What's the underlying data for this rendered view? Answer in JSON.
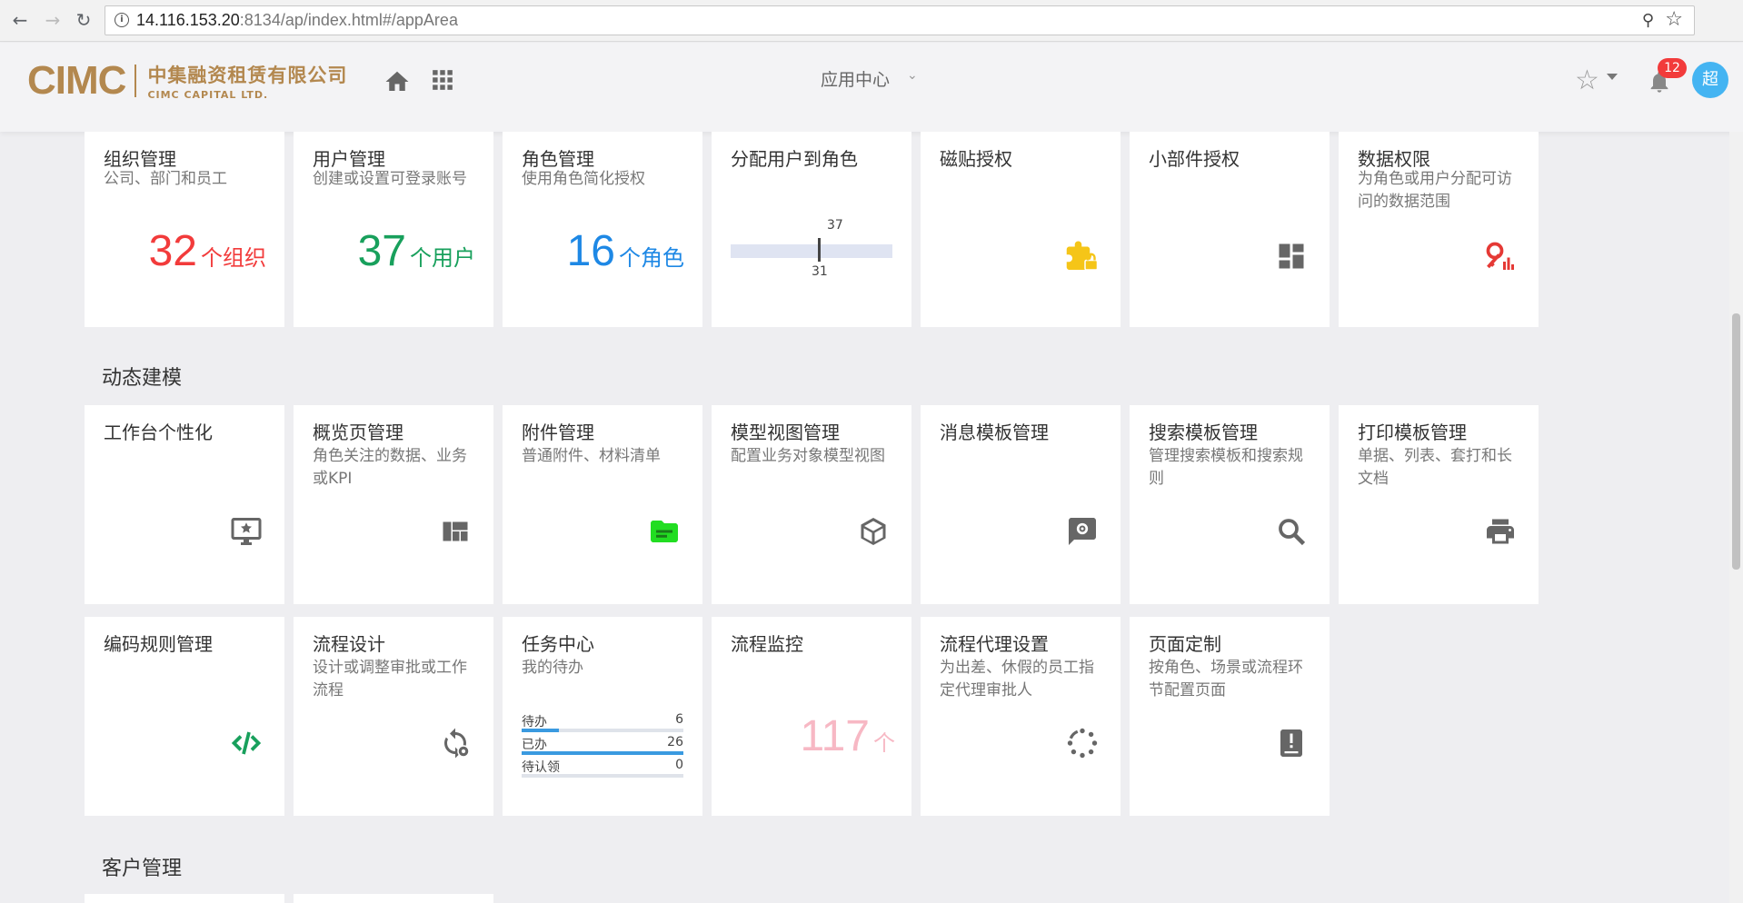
{
  "browser": {
    "url_host": "14.116.153.20",
    "url_rest": ":8134/ap/index.html#/appArea"
  },
  "header": {
    "logo_mark": "CIMC",
    "logo_cn": "中集融资租赁有限公司",
    "logo_en": "CIMC CAPITAL LTD.",
    "app_center": "应用中心",
    "notifications": "12",
    "avatar": "超"
  },
  "sections": {
    "dynamic_modeling": "动态建模",
    "customer_mgmt": "客户管理"
  },
  "tiles": {
    "org": {
      "title": "组织管理",
      "desc": "公司、部门和员工",
      "count": "32",
      "unit": "个组织",
      "color": "#f23b3b"
    },
    "user": {
      "title": "用户管理",
      "desc": "创建或设置可登录账号",
      "count": "37",
      "unit": "个用户",
      "color": "#18a05c"
    },
    "role": {
      "title": "角色管理",
      "desc": "使用角色简化授权",
      "count": "16",
      "unit": "个角色",
      "color": "#1e88e5"
    },
    "assign": {
      "title": "分配用户到角色",
      "top_value": "37",
      "bottom_value": "31"
    },
    "tile_auth": {
      "title": "磁贴授权",
      "icon": "puzzle-lock-icon"
    },
    "widget_auth": {
      "title": "小部件授权",
      "icon": "dashboard-icon"
    },
    "data_perm": {
      "title": "数据权限",
      "desc": "为角色或用户分配可访问的数据范围",
      "icon": "key-chart-icon"
    },
    "workbench": {
      "title": "工作台个性化",
      "icon": "monitor-star-icon"
    },
    "overview": {
      "title": "概览页管理",
      "desc": "角色关注的数据、业务或KPI",
      "icon": "layout-icon"
    },
    "attachment": {
      "title": "附件管理",
      "desc": "普通附件、材料清单",
      "icon": "folder-icon"
    },
    "model_view": {
      "title": "模型视图管理",
      "desc": "配置业务对象模型视图",
      "icon": "cube-icon"
    },
    "msg_template": {
      "title": "消息模板管理",
      "icon": "message-gear-icon"
    },
    "search_template": {
      "title": "搜索模板管理",
      "desc": "管理搜索模板和搜索规则",
      "icon": "search-icon"
    },
    "print_template": {
      "title": "打印模板管理",
      "desc": "单据、列表、套打和长文档",
      "icon": "printer-icon"
    },
    "code_rule": {
      "title": "编码规则管理",
      "icon": "code-icon"
    },
    "flow_design": {
      "title": "流程设计",
      "desc": "设计或调整审批或工作流程",
      "icon": "sync-gear-icon"
    },
    "task_center": {
      "title": "任务中心",
      "desc": "我的待办",
      "rows": [
        {
          "label": "待办",
          "value": "6",
          "fraction": 0.23
        },
        {
          "label": "已办",
          "value": "26",
          "fraction": 1.0
        },
        {
          "label": "待认领",
          "value": "0",
          "fraction": 0
        }
      ]
    },
    "flow_monitor": {
      "title": "流程监控",
      "count": "117",
      "unit": "个",
      "color": "#f7b8c4"
    },
    "flow_delegate": {
      "title": "流程代理设置",
      "desc": "为出差、休假的员工指定代理审批人",
      "icon": "loading-circle-icon"
    },
    "page_custom": {
      "title": "页面定制",
      "desc": "按角色、场景或流程环节配置页面",
      "icon": "book-alert-icon"
    }
  }
}
